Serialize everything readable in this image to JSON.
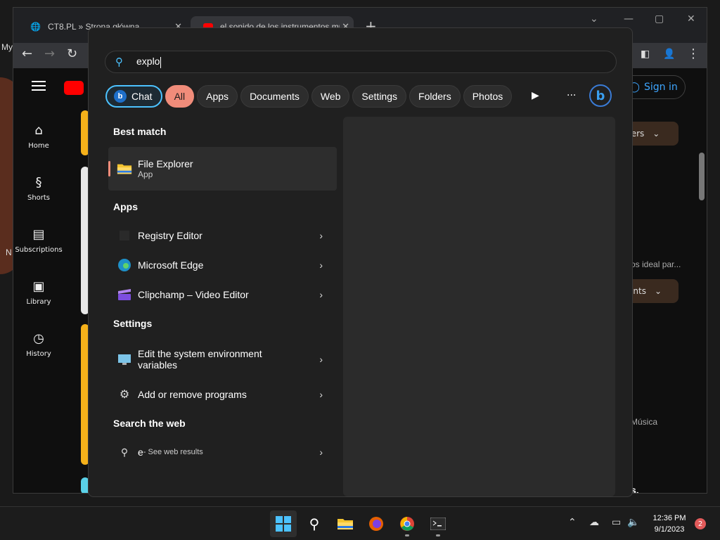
{
  "desktop": {
    "left_text_1": "My",
    "left_text_2": "N"
  },
  "browser": {
    "tabs": [
      {
        "title": "CT8.PL » Strona główna"
      },
      {
        "title": "el sonido de los instrumentos mu..."
      }
    ],
    "new_tab": "+",
    "youtube": {
      "nav": [
        {
          "label": "Home",
          "icon": "home-icon"
        },
        {
          "label": "Shorts",
          "icon": "shorts-icon"
        },
        {
          "label": "Subscriptions",
          "icon": "subscriptions-icon"
        },
        {
          "label": "Library",
          "icon": "library-icon"
        },
        {
          "label": "History",
          "icon": "history-icon"
        }
      ],
      "sign_in": "Sign in",
      "chip_filters": "ters",
      "chip_comments": "ents",
      "snippet_1": "os ideal par...",
      "snippet_2": "Música",
      "snippet_3": "s."
    }
  },
  "search": {
    "query": "explo",
    "filters": [
      "Chat",
      "All",
      "Apps",
      "Documents",
      "Web",
      "Settings",
      "Folders",
      "Photos"
    ],
    "selected_filter": "All",
    "sections": {
      "best_match": "Best match",
      "apps": "Apps",
      "settings": "Settings",
      "web": "Search the web"
    },
    "best_match": {
      "name": "File Explorer",
      "type": "App"
    },
    "apps": [
      {
        "name": "Registry Editor"
      },
      {
        "name": "Microsoft Edge"
      },
      {
        "name": "Clipchamp – Video Editor"
      }
    ],
    "settings": [
      {
        "line1": "Edit the system environment",
        "line2": "variables"
      },
      {
        "name": "Add or remove programs"
      }
    ],
    "web": {
      "term": "e",
      "suffix": " - See web results"
    }
  },
  "taskbar": {
    "time": "12:36 PM",
    "date": "9/1/2023",
    "notifications": "2"
  },
  "colors": {
    "accent": "#4cc2ff",
    "selected_chip": "#f08c7a",
    "flyout_bg": "#202020"
  }
}
